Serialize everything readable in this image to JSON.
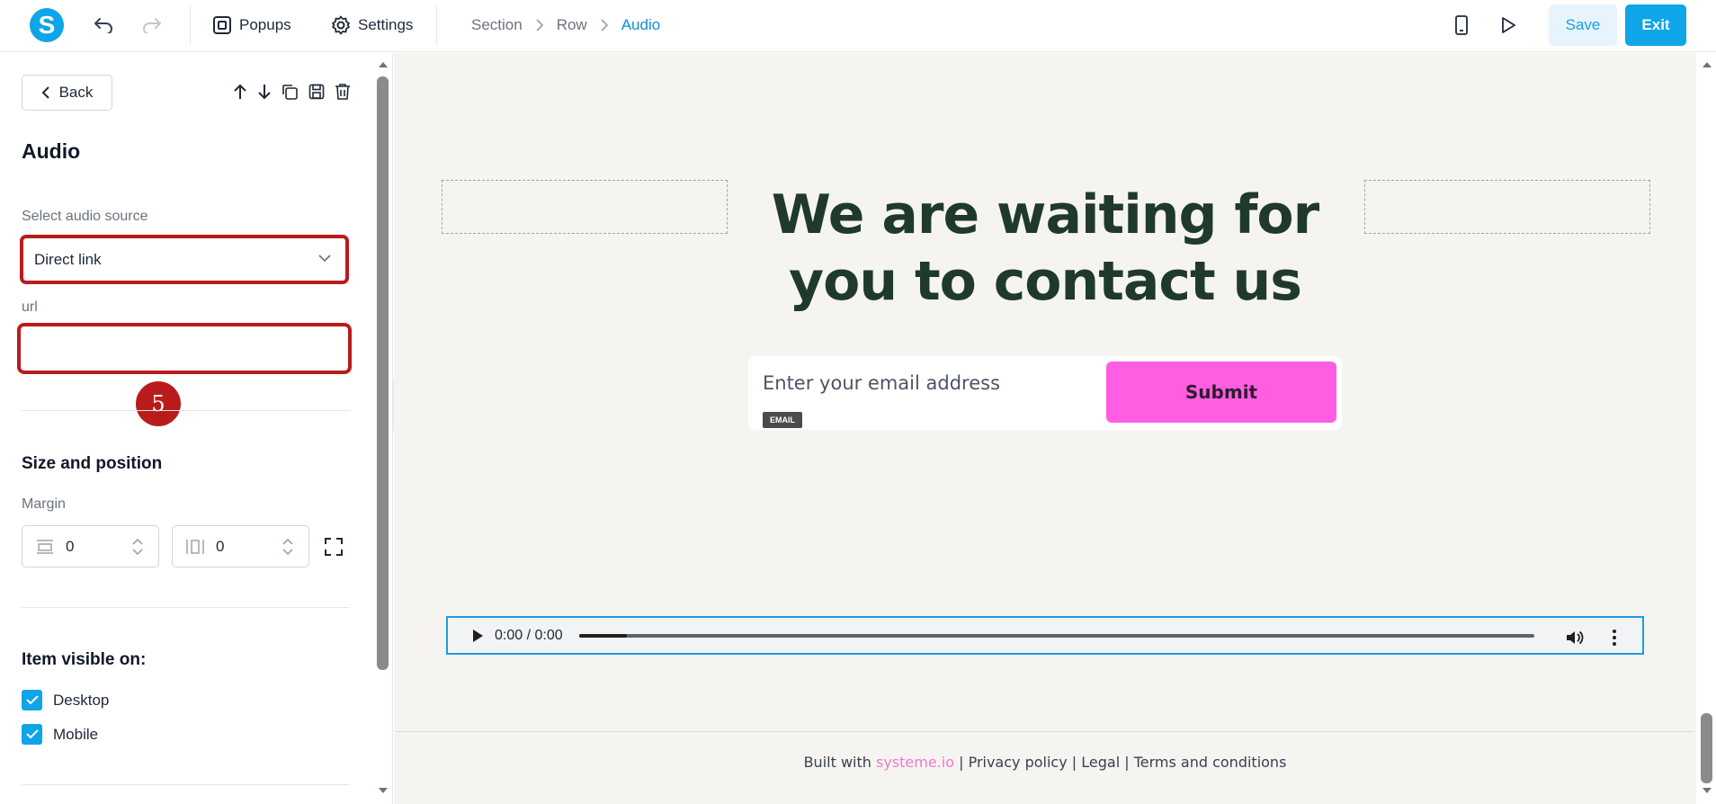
{
  "topbar": {
    "logo_letter": "S",
    "popups_label": "Popups",
    "settings_label": "Settings",
    "breadcrumbs": [
      "Section",
      "Row",
      "Audio"
    ],
    "save_label": "Save",
    "exit_label": "Exit"
  },
  "sidebar": {
    "back_label": "Back",
    "title": "Audio",
    "audio_source_label": "Select audio source",
    "audio_source_value": "Direct link",
    "url_label": "url",
    "url_value": "",
    "step_badge": "5",
    "size_position_title": "Size and position",
    "margin_label": "Margin",
    "margin_vertical": "0",
    "margin_horizontal": "0",
    "visible_on_title": "Item visible on:",
    "visible_desktop_label": "Desktop",
    "visible_mobile_label": "Mobile",
    "visible_desktop_checked": true,
    "visible_mobile_checked": true
  },
  "canvas": {
    "headline_line1": "We are waiting for",
    "headline_line2": "you to contact us",
    "email_placeholder": "Enter your email address",
    "email_tag": "EMAIL",
    "submit_label": "Submit",
    "audio_time": "0:00 / 0:00",
    "audio_progress_fraction": 0.05,
    "footer_built_with": "Built with",
    "footer_brand": "systeme.io",
    "footer_links": "| Privacy policy | Legal | Terms and conditions"
  },
  "colors": {
    "accent": "#0ea5e9",
    "highlight_border": "#b91c1c",
    "submit_bg": "#ff5ee3",
    "headline": "#1f3a2c",
    "canvas_bg": "#f6f4f0"
  }
}
